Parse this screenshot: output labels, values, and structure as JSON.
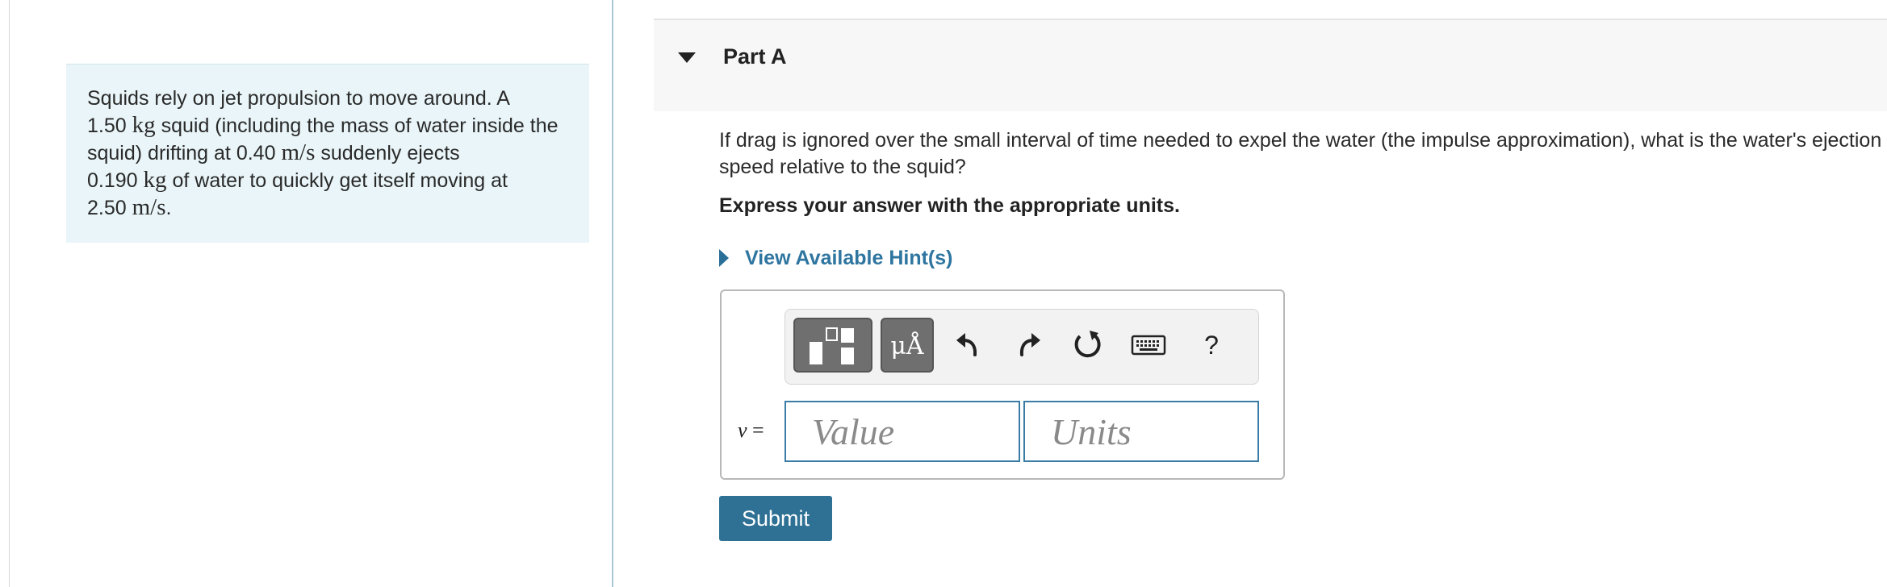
{
  "problem": {
    "text_1": "Squids rely on jet propulsion to move around. A",
    "m1_value": "1.50",
    "kg_unit": "kg",
    "text_2": "squid (including the mass of water inside the squid) drifting at",
    "v1_value": "0.40",
    "ms_unit": "m/s",
    "text_3": "suddenly ejects",
    "m2_value": "0.190",
    "text_4": "of water to quickly get itself moving at",
    "v2_value": "2.50",
    "period": "."
  },
  "part": {
    "title": "Part A",
    "question": "If drag is ignored over the small interval of time needed to expel the water (the impulse approximation), what is the water's ejection speed relative to the squid?",
    "instruction": "Express your answer with the appropriate units.",
    "hint_label": "View Available Hint(s)"
  },
  "toolbar": {
    "symbols_label": "μÅ",
    "help_label": "?",
    "icons": [
      "templates-icon",
      "symbols-icon",
      "undo-icon",
      "redo-icon",
      "reset-icon",
      "keyboard-icon",
      "help-icon"
    ]
  },
  "answer": {
    "variable": "v",
    "equals": "=",
    "value_placeholder": "Value",
    "units_placeholder": "Units"
  },
  "submit_label": "Submit",
  "colors": {
    "accent": "#2e7194",
    "link": "#2e75a0",
    "problem_bg": "#e9f5f8",
    "field_border": "#3a7ca5"
  }
}
